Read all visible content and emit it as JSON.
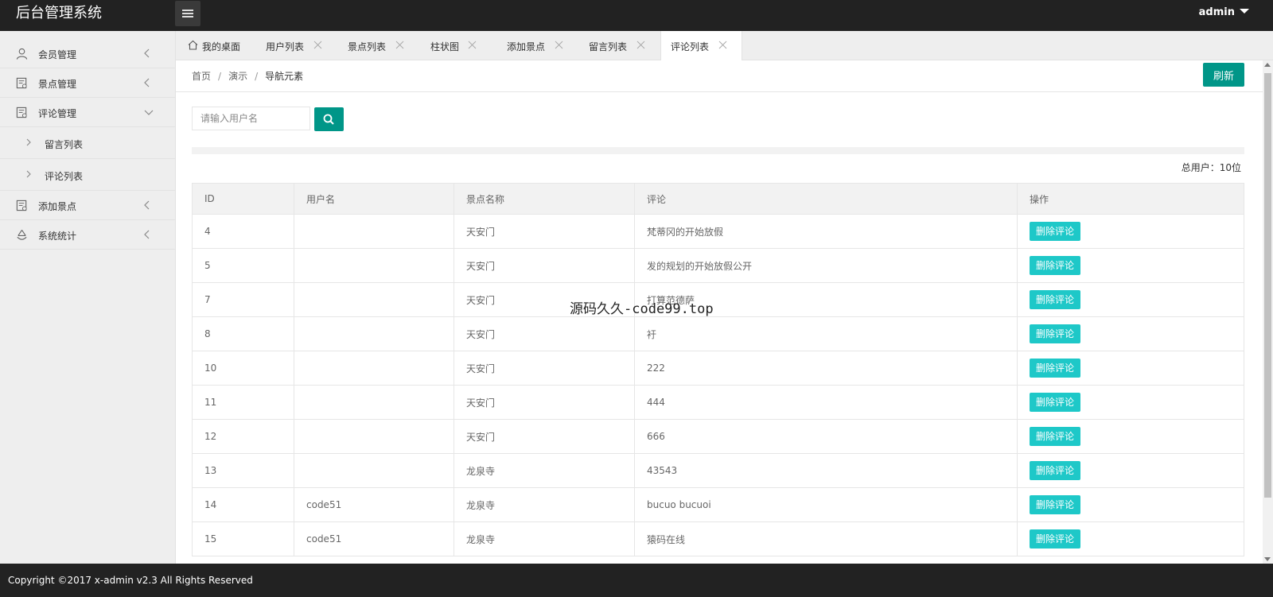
{
  "header": {
    "logo": "后台管理系统",
    "user": "admin"
  },
  "sidebar": {
    "items": [
      {
        "label": "会员管理",
        "icon": "user-icon"
      },
      {
        "label": "景点管理",
        "icon": "document-icon"
      },
      {
        "label": "评论管理",
        "icon": "document-icon",
        "expanded": true
      },
      {
        "label": "添加景点",
        "icon": "document-icon"
      },
      {
        "label": "系统统计",
        "icon": "recycle-icon"
      }
    ],
    "subitems": [
      {
        "label": "留言列表"
      },
      {
        "label": "评论列表"
      }
    ]
  },
  "tabs": [
    {
      "label": "我的桌面"
    },
    {
      "label": "用户列表"
    },
    {
      "label": "景点列表"
    },
    {
      "label": "柱状图"
    },
    {
      "label": "添加景点"
    },
    {
      "label": "留言列表"
    },
    {
      "label": "评论列表",
      "active": true
    }
  ],
  "breadcrumb": {
    "items": [
      "首页",
      "演示",
      "导航元素"
    ],
    "separator": "/"
  },
  "toolbar": {
    "refresh_label": "刷新",
    "search_placeholder": "请输入用户名"
  },
  "summary": {
    "total": "总用户：10位"
  },
  "table": {
    "headers": [
      "ID",
      "用户名",
      "景点名称",
      "评论",
      "操作"
    ],
    "action_label": "删除评论",
    "rows": [
      {
        "id": "4",
        "user": "",
        "spot": "天安门",
        "comment": "梵蒂冈的开始放假"
      },
      {
        "id": "5",
        "user": "",
        "spot": "天安门",
        "comment": "发的规划的开始放假公开"
      },
      {
        "id": "7",
        "user": "",
        "spot": "天安门",
        "comment": "打算范德萨"
      },
      {
        "id": "8",
        "user": "",
        "spot": "天安门",
        "comment": "衧"
      },
      {
        "id": "10",
        "user": "",
        "spot": "天安门",
        "comment": "222"
      },
      {
        "id": "11",
        "user": "",
        "spot": "天安门",
        "comment": "444"
      },
      {
        "id": "12",
        "user": "",
        "spot": "天安门",
        "comment": "666"
      },
      {
        "id": "13",
        "user": "",
        "spot": "龙泉寺",
        "comment": "43543"
      },
      {
        "id": "14",
        "user": "code51",
        "spot": "龙泉寺",
        "comment": "bucuo bucuoi"
      },
      {
        "id": "15",
        "user": "code51",
        "spot": "龙泉寺",
        "comment": "猿码在线"
      }
    ]
  },
  "watermark": "源码久久-code99.top",
  "footer": {
    "copyright": "Copyright ©2017 x-admin v2.3 All Rights Reserved"
  },
  "colors": {
    "header_bg": "#222222",
    "primary": "#009688",
    "delete_button": "#1ec8c8",
    "sidebar_bg": "#eeeeee"
  }
}
